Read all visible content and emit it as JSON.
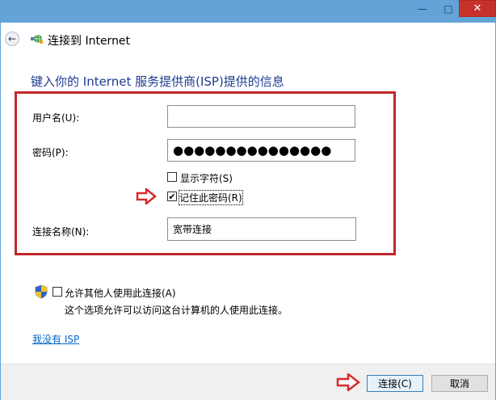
{
  "window": {
    "minimize_glyph": "—",
    "maximize_glyph": "□",
    "close_glyph": "✕"
  },
  "header": {
    "title": "连接到 Internet",
    "back_icon": "back-arrow-icon",
    "app_icon": "network-globe-icon"
  },
  "instruction": "键入你的 Internet 服务提供商(ISP)提供的信息",
  "form": {
    "username_label": "用户名(U):",
    "username_value": "",
    "password_label": "密码(P):",
    "password_value": "●●●●●●●●●●●●●●●",
    "show_chars_label": "显示字符(S)",
    "show_chars_checked": false,
    "remember_label": "记住此密码(R)",
    "remember_checked": true,
    "connection_name_label": "连接名称(N):",
    "connection_name_value": "宽带连接"
  },
  "allow_others": {
    "label": "允许其他人使用此连接(A)",
    "checked": false,
    "note": "这个选项允许可以访问这台计算机的人使用此连接。",
    "icon": "uac-shield-icon"
  },
  "no_isp_link": "我没有 ISP",
  "footer": {
    "connect_label": "连接(C)",
    "cancel_label": "取消"
  },
  "colors": {
    "titlebar": "#64a3d8",
    "instruction": "#1c3b8f",
    "highlight_box": "#c0272d",
    "arrow": "#d72b2b",
    "link": "#0066cc"
  }
}
